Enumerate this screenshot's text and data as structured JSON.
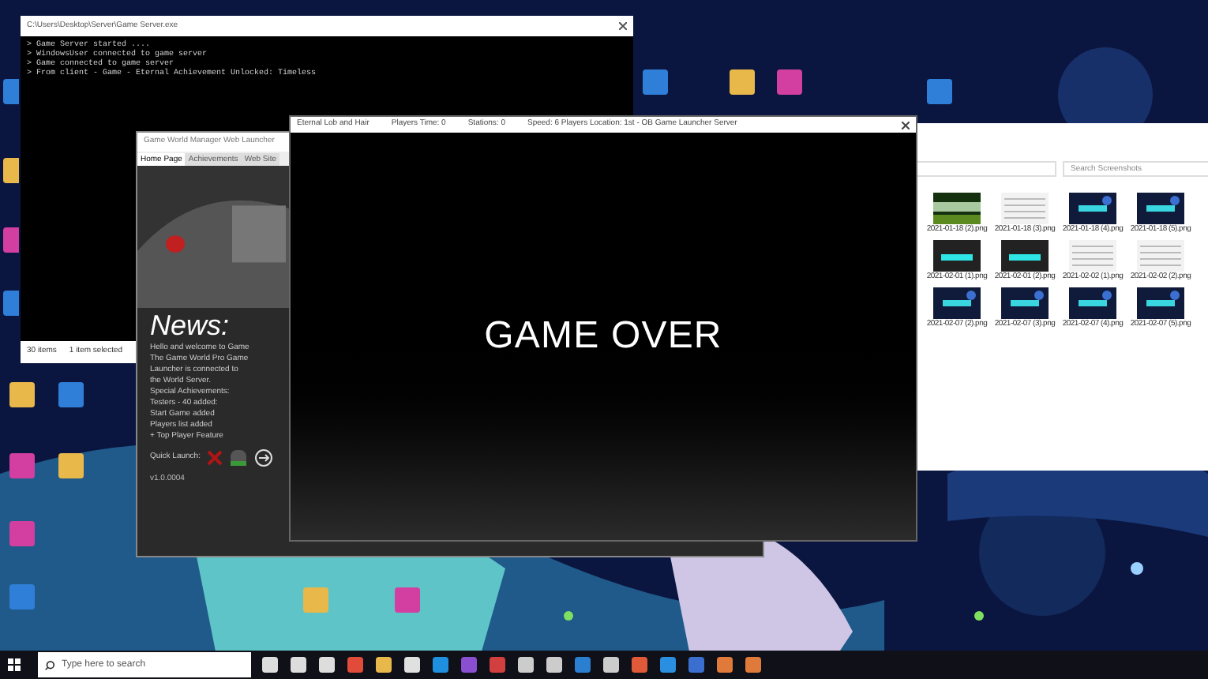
{
  "console_window": {
    "title": "C:\\Users\\Desktop\\Server\\Game Server.exe",
    "lines": [
      "> Game Server started ....",
      "> WindowsUser connected to game server",
      "> Game connected to game server",
      "> From client - Game - Eternal Achievement Unlocked: Timeless"
    ]
  },
  "explorer_status": {
    "items": "30 items",
    "selection": "1 item selected"
  },
  "launcher_window": {
    "title": "Game World Manager Web Launcher",
    "tabs": [
      {
        "label": "Home Page",
        "selected": true
      },
      {
        "label": "Achievements",
        "selected": false
      },
      {
        "label": "Web Site",
        "selected": false
      }
    ],
    "news_title": "News:",
    "news_lines": [
      "Hello and welcome to Game",
      "The Game World Pro Game",
      "Launcher is connected to",
      "the World Server.",
      "Special Achievements:",
      "Testers - 40 added:",
      "Start Game added",
      "Players list added",
      "+ Top Player Feature"
    ],
    "launch_label": "Quick Launch:",
    "version": "v1.0.0004"
  },
  "game_window": {
    "title_parts": [
      "Eternal Lob and Hair",
      "Players Time: 0",
      "Stations: 0",
      "Speed: 6 Players Location: 1st - OB Game Launcher Server"
    ],
    "message": "GAME OVER"
  },
  "explorer_window": {
    "search_placeholder": "Search Screenshots",
    "files": [
      {
        "name": "2021-01-18 (2).png",
        "kind": "game"
      },
      {
        "name": "2021-01-18 (3).png",
        "kind": "sheet"
      },
      {
        "name": "2021-01-18 (4).png",
        "kind": "space"
      },
      {
        "name": "2021-01-18 (5).png",
        "kind": "space"
      },
      {
        "name": "2021-02-01 (1).png",
        "kind": "dark"
      },
      {
        "name": "2021-02-01 (2).png",
        "kind": "dark"
      },
      {
        "name": "2021-02-02 (1).png",
        "kind": "sheet"
      },
      {
        "name": "2021-02-02 (2).png",
        "kind": "sheet"
      },
      {
        "name": "2021-02-07 (2).png",
        "kind": "space"
      },
      {
        "name": "2021-02-07 (3).png",
        "kind": "space"
      },
      {
        "name": "2021-02-07 (4).png",
        "kind": "space"
      },
      {
        "name": "2021-02-07 (5).png",
        "kind": "space"
      }
    ]
  },
  "taskbar": {
    "search_placeholder": "Type here to search"
  }
}
